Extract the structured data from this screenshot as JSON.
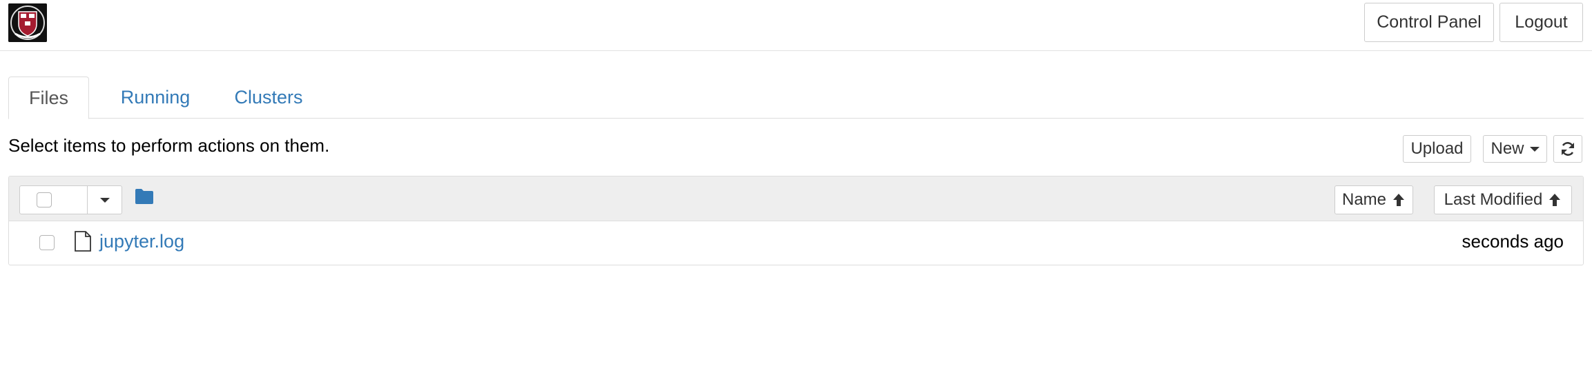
{
  "header": {
    "logo_icon": "university-shield-logo",
    "control_panel_label": "Control Panel",
    "logout_label": "Logout"
  },
  "tabs": [
    {
      "label": "Files",
      "active": true
    },
    {
      "label": "Running",
      "active": false
    },
    {
      "label": "Clusters",
      "active": false
    }
  ],
  "toolbar": {
    "instructions": "Select items to perform actions on them.",
    "upload_label": "Upload",
    "new_label": "New",
    "refresh_icon": "refresh-icon"
  },
  "list": {
    "sort_name_label": "Name",
    "sort_modified_label": "Last Modified",
    "folder_icon": "folder-icon",
    "items": [
      {
        "name": "jupyter.log",
        "modified": "seconds ago",
        "icon": "file-icon"
      }
    ]
  },
  "colors": {
    "link": "#337ab7",
    "header_bg": "#eeeeee",
    "border": "#dddddd"
  }
}
